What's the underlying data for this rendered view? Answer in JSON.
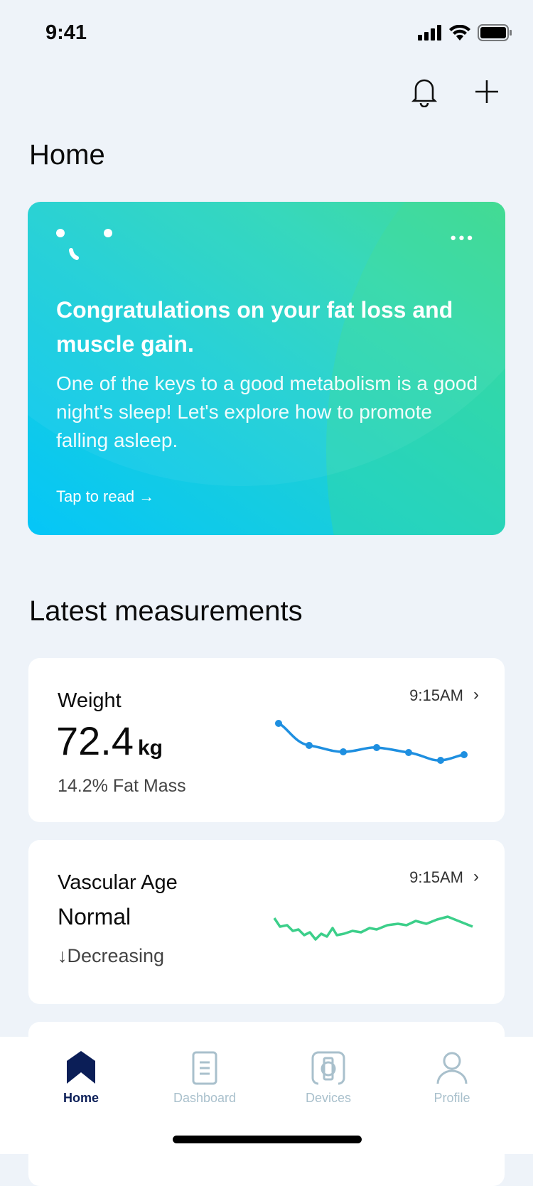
{
  "status_bar": {
    "time": "9:41"
  },
  "header": {
    "title": "Home",
    "icons": [
      "bell-icon",
      "plus-icon"
    ]
  },
  "banner": {
    "logo": "smile-icon",
    "headline": "Congratulations on your fat loss and muscle gain.",
    "body": "One of the keys to a good metabolism is a good night's sleep! Let's explore how to promote falling asleep.",
    "link": "Tap to read →",
    "menu": "more-icon",
    "gradient": [
      "#05c6f8",
      "#37d98f"
    ]
  },
  "measurements": {
    "title": "Latest measurements",
    "cards": [
      {
        "label": "Weight",
        "value": "72.4",
        "unit": "kg",
        "sub": "14.2% Fat Mass",
        "time": "9:15AM",
        "color": "#1e8fe0"
      },
      {
        "label": "Vascular Age",
        "value": "Normal",
        "sub": "Decreasing",
        "time": "9:15AM",
        "color": "#3ccf8a"
      }
    ]
  },
  "tabs": [
    {
      "label": "Home",
      "active": true
    },
    {
      "label": "Dashboard"
    },
    {
      "label": "Devices"
    },
    {
      "label": "Profile"
    }
  ],
  "colors": {
    "active_tab": "#0b1e57",
    "inactive_tab": "#a9c0cc",
    "background": "#eef3f9"
  }
}
